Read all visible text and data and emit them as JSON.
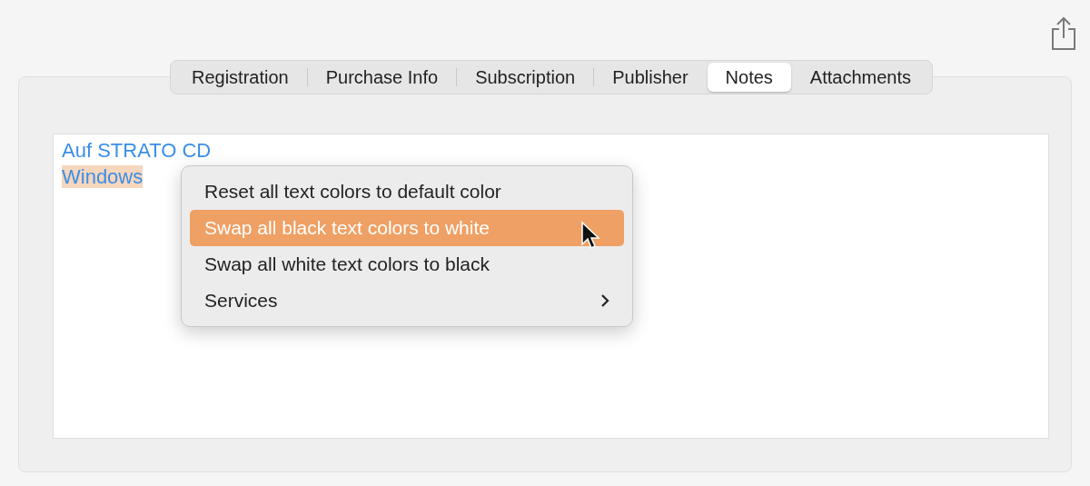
{
  "tabs": [
    {
      "label": "Registration",
      "selected": false
    },
    {
      "label": "Purchase Info",
      "selected": false
    },
    {
      "label": "Subscription",
      "selected": false
    },
    {
      "label": "Publisher",
      "selected": false
    },
    {
      "label": "Notes",
      "selected": true
    },
    {
      "label": "Attachments",
      "selected": false
    }
  ],
  "notes": {
    "lines": [
      {
        "text": "Auf STRATO CD",
        "selected": false
      },
      {
        "text": "Windows",
        "selected": true
      }
    ]
  },
  "context_menu": {
    "items": [
      {
        "label": "Reset all text colors to default color",
        "kind": "action",
        "selected": false
      },
      {
        "label": "Swap all black text colors to white",
        "kind": "action",
        "selected": true
      },
      {
        "label": "Swap all white text colors to black",
        "kind": "action",
        "selected": false
      },
      {
        "label": "Services",
        "kind": "submenu",
        "selected": false
      }
    ]
  }
}
